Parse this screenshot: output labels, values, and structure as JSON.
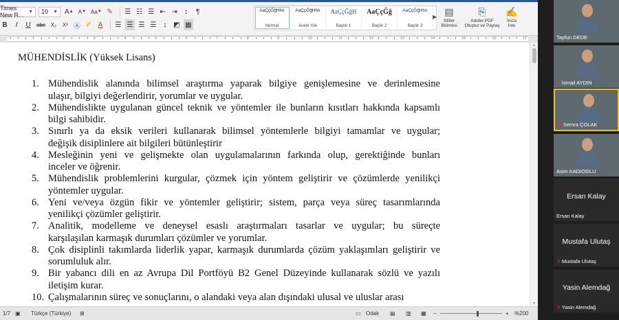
{
  "ribbon": {
    "font_name": "Times New R...",
    "font_size": "10",
    "grow_font": "A",
    "shrink_font": "A",
    "format_painter": "Aa",
    "bold": "B",
    "italic": "I",
    "underline": "U",
    "strike": "abc",
    "subscript": "X₂",
    "superscript": "X²",
    "font_color_letter": "A",
    "pilcrow": "¶",
    "styles": [
      {
        "sample": "AaÇçĞğHhIı",
        "name": "Normal",
        "active": true
      },
      {
        "sample": "AaÇçĞğHhIı",
        "name": "Aralık Yok"
      },
      {
        "sample": "AaÇçĞğH",
        "name": "Başlık 1"
      },
      {
        "sample": "AaÇçĞğ",
        "name": "Başlık 2"
      },
      {
        "sample": "AaÇçĞğHhIı",
        "name": "Başlık 3"
      }
    ],
    "styles_pane": "Stiller\nBölmesi",
    "adobe_pdf": "Adobe PDF\nOluştur ve Paylaş",
    "sign": "İmza\nİste"
  },
  "ruler": {
    "numbers": [
      "1",
      "2",
      "3",
      "4",
      "5",
      "6",
      "7",
      "8",
      "9",
      "10",
      "11",
      "12",
      "13",
      "14",
      "15",
      "16",
      "17"
    ]
  },
  "document": {
    "heading": "MÜHENDİSLİK  (Yüksek Lisans)",
    "items": [
      {
        "num": "1.",
        "lines": [
          "Mühendislik alanında bilimsel araştırma yaparak bilgiye genişlemesine ve derinlemesine",
          "ulaşır, bilgiyi değerlendirir, yorumlar ve uygular."
        ]
      },
      {
        "num": "2.",
        "lines": [
          "Mühendislikte uygulanan güncel teknik ve yöntemler ile bunların kısıtları hakkında kapsamlı",
          "bilgi sahibidir."
        ]
      },
      {
        "num": "3.",
        "lines": [
          "Sınırlı ya da eksik verileri kullanarak bilimsel yöntemlerle bilgiyi tamamlar ve uygular;",
          "değişik disiplinlere ait bilgileri bütünleştirir"
        ]
      },
      {
        "num": "4.",
        "lines": [
          "Mesleğinin yeni ve gelişmekte olan uygulamalarının farkında olup, gerektiğinde bunları",
          "inceler ve öğrenir."
        ]
      },
      {
        "num": "5.",
        "lines": [
          "Mühendislik problemlerini kurgular, çözmek için yöntem geliştirir ve çözümlerde yenilikçi",
          "yöntemler uygular."
        ]
      },
      {
        "num": "6.",
        "lines": [
          "Yeni ve/veya özgün fikir ve yöntemler geliştirir; sistem, parça veya süreç tasarımlarında",
          "yenilikçi çözümler geliştirir."
        ]
      },
      {
        "num": "7.",
        "lines": [
          "Analitik, modelleme ve deneysel esaslı araştırmaları tasarlar ve uygular; bu süreçte",
          "karşılaşılan karmaşık durumları çözümler ve yorumlar."
        ]
      },
      {
        "num": "8.",
        "lines": [
          "Çok disiplinli takımlarda liderlik yapar, karmaşık durumlarda çözüm yaklaşımları geliştirir ve",
          "sorumluluk alır."
        ]
      },
      {
        "num": "9.",
        "lines": [
          "Bir yabancı dili en az Avrupa Dil Portföyü B2 Genel Düzeyinde kullanarak sözlü ve yazılı",
          "iletişim kurar."
        ]
      },
      {
        "num": "10.",
        "lines": [
          "Çalışmalarının süreç ve sonuçlarını, o alandaki veya alan dışındaki ulusal ve uluslar arası"
        ]
      }
    ]
  },
  "status": {
    "page": "1/7",
    "language": "Türkçe (Türkiye)",
    "focus": "Odak",
    "zoom": "%200",
    "zoom_level": 0.6
  },
  "participants": [
    {
      "name": "Tayfun DEDE",
      "video": true,
      "muted": false
    },
    {
      "name": "İsmail AYDIN",
      "video": true,
      "muted": true
    },
    {
      "name": "Semra  ÇOLAK",
      "video": true,
      "muted": true,
      "active": true
    },
    {
      "name": "Asim KADIOGLU",
      "video": true,
      "muted": false
    },
    {
      "name": "Ersan Kalay",
      "video": false,
      "muted": false,
      "display": "Ersan Kalay"
    },
    {
      "name": "Mustafa Ulutaş",
      "video": false,
      "muted": true,
      "display": "Mustafa Ulutaş"
    },
    {
      "name": "Yasin Alemdağ",
      "video": false,
      "muted": true,
      "display": "Yasin Alemdağ"
    }
  ]
}
